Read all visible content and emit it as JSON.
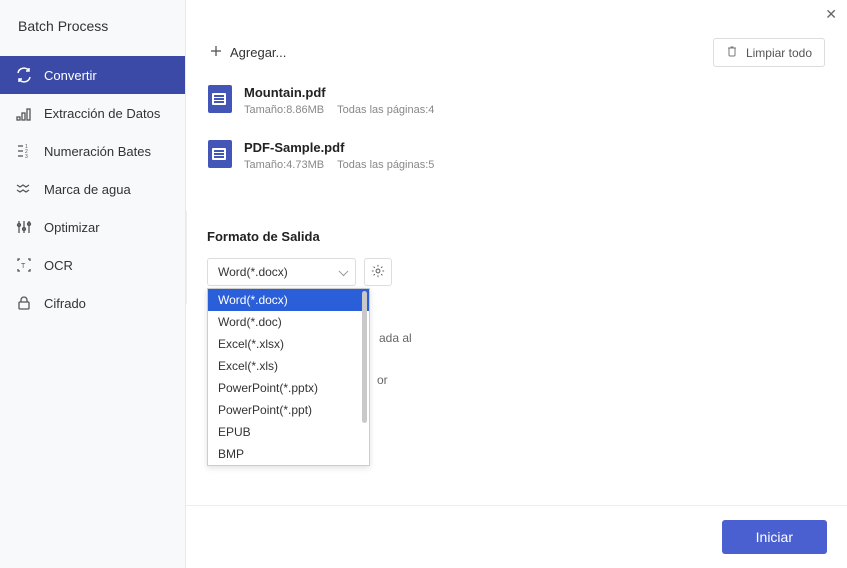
{
  "window": {
    "title": "Batch Process"
  },
  "sidebar": {
    "items": [
      {
        "label": "Convertir",
        "icon": "convert-icon",
        "active": true
      },
      {
        "label": "Extracción de Datos",
        "icon": "data-extract-icon",
        "active": false
      },
      {
        "label": "Numeración Bates",
        "icon": "bates-icon",
        "active": false
      },
      {
        "label": "Marca de agua",
        "icon": "watermark-icon",
        "active": false
      },
      {
        "label": "Optimizar",
        "icon": "optimize-icon",
        "active": false
      },
      {
        "label": "OCR",
        "icon": "ocr-icon",
        "active": false
      },
      {
        "label": "Cifrado",
        "icon": "encrypt-icon",
        "active": false
      }
    ]
  },
  "toolbar": {
    "add_label": "Agregar...",
    "clear_label": "Limpiar todo"
  },
  "files": [
    {
      "name": "Mountain.pdf",
      "size_label": "Tamaño:8.86MB",
      "pages_label": "Todas las páginas:4"
    },
    {
      "name": "PDF-Sample.pdf",
      "size_label": "Tamaño:4.73MB",
      "pages_label": "Todas las páginas:5"
    }
  ],
  "right_panel": {
    "heading": "Formato de Salida",
    "selected": "Word(*.docx)",
    "options": [
      "Word(*.docx)",
      "Word(*.doc)",
      "Excel(*.xlsx)",
      "Excel(*.xls)",
      "PowerPoint(*.pptx)",
      "PowerPoint(*.ppt)",
      "EPUB",
      "BMP"
    ],
    "hint_frag1": "ada al",
    "hint_frag2": "or"
  },
  "footer": {
    "start_label": "Iniciar"
  }
}
